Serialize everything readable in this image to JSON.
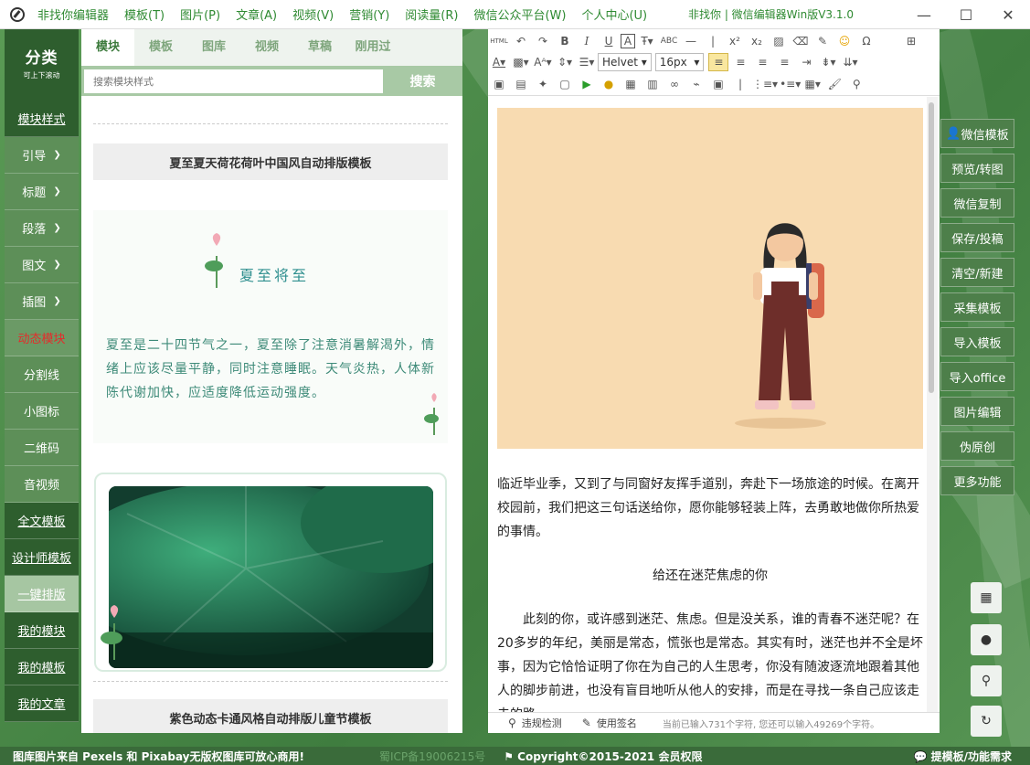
{
  "menu": [
    "非找你编辑器",
    "模板(T)",
    "图片(P)",
    "文章(A)",
    "视频(V)",
    "营销(Y)",
    "阅读量(R)",
    "微信公众平台(W)",
    "个人中心(U)"
  ],
  "app_title": "非找你 | 微信编辑器Win版V3.1.0",
  "window_buttons": {
    "minimize": "—",
    "maximize": "☐",
    "close": "✕"
  },
  "categories": {
    "header_title": "分类",
    "header_sub": "可上下滚动",
    "items": [
      "模块样式",
      "引导",
      "标题",
      "段落",
      "图文",
      "插图",
      "动态模块",
      "分割线",
      "小图标",
      "二维码",
      "音视频",
      "全文模板",
      "设计师模板",
      "一键排版",
      "我的模块",
      "我的模板",
      "我的文章"
    ]
  },
  "tabs": [
    "模块",
    "模板",
    "图库",
    "视频",
    "草稿",
    "刚用过"
  ],
  "search": {
    "placeholder": "搜索模块样式",
    "button": "搜索"
  },
  "templates": [
    {
      "title": "夏至夏天荷花荷叶中国风自动排版模板"
    },
    {
      "title": "紫色动态卡通风格自动排版儿童节模板"
    }
  ],
  "card": {
    "heading": "夏至将至",
    "text": "夏至是二十四节气之一，夏至除了注意消暑解渴外，情绪上应该尽量平静，同时注意睡眠。天气炎热，人体新陈代谢加快，应适度降低运动强度。"
  },
  "toolbar": {
    "html_label": "HTML",
    "font": "Helvet",
    "size": "16px"
  },
  "article": {
    "p1": "临近毕业季，又到了与同窗好友挥手道别，奔赴下一场旅途的时候。在离开校园前，我们把这三句话送给你，愿你能够轻装上阵，去勇敢地做你所热爱的事情。",
    "p2": "给还在迷茫焦虑的你",
    "p3": "此刻的你，或许感到迷茫、焦虑。但是没关系，谁的青春不迷茫呢？在20多岁的年纪，美丽是常态，慌张也是常态。其实有时，迷茫也并不全是坏事，因为它恰恰证明了你在为自己的人生思考，你没有随波逐流地跟着其他人的脚步前进，也没有盲目地听从他人的安排，而是在寻找一条自己应该走去的路。"
  },
  "status": {
    "check": "违规检测",
    "sign": "使用签名",
    "count": "当前已输入731个字符, 您还可以输入49269个字符。"
  },
  "actions": [
    "微信模板",
    "预览/转图",
    "微信复制",
    "保存/投稿",
    "清空/新建",
    "采集模板",
    "导入模板",
    "导入office",
    "图片编辑",
    "伪原创",
    "更多功能"
  ],
  "side_icons": [
    "calendar-icon",
    "qq-icon",
    "search-icon",
    "refresh-icon"
  ],
  "footer": {
    "left": "图库图片来自 Pexels 和 Pixabay无版权图库可放心商用!",
    "icp": "蜀ICP备19006215号",
    "copyright": "Copyright©2015-2021 会员权限",
    "right": "提模板/功能需求"
  },
  "colors": {
    "brand_green": "#2e5e2e",
    "menu_green": "#2f8a32",
    "highlight_red": "#e52b2b"
  }
}
